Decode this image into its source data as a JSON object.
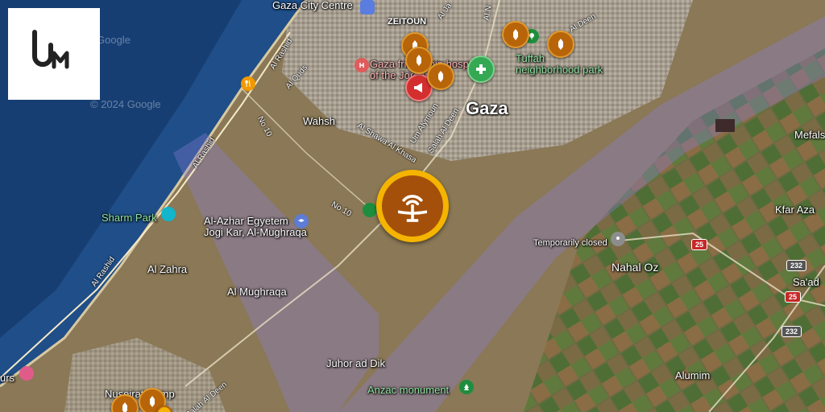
{
  "map": {
    "places": {
      "gaza_city_centre": "Gaza City Centre",
      "zeitoun": "ZEITOUN",
      "gaza": "Gaza",
      "wahsh": "Wahsh",
      "tuffah_park": "Tuffah\nneighborhood park",
      "sharm_park": "Sharm Park",
      "al_azhar": "Al-Azhar Egyetem\nJogi Kar, Al-Mughraqa",
      "al_zahra": "Al Zahra",
      "al_mughraqa": "Al Mughraqa",
      "juhor_ad_dik": "Juhor ad Dik",
      "anzac_monument": "Anzac monument",
      "nahal_oz": "Nahal Oz",
      "kfar_aza": "Kfar Aza",
      "saad": "Sa'ad",
      "alumim": "Alumim",
      "mefals": "Mefals",
      "nuseirat_camp": "Nuseirat Camp",
      "urs": "urs",
      "temporarily_closed": "Temporarily closed",
      "gaza_hospital": "Gaza friendship hospital\nof the Jordan"
    },
    "roads": {
      "al_rashid_1": "Al Rashid",
      "al_rashid_2": "Al Rashid",
      "al_rashid_3": "Al Rashid",
      "al_quds": "Al Quds",
      "no10_a": "No 10",
      "no10_b": "No 10",
      "al_shawa": "Al Shawa Al Khasa",
      "um_alymoun": "Um Alymoun",
      "salah_al_deen_1": "Salah Al Deen",
      "salah_al_deen_2": "Salah Al Deen",
      "al_deen": "Al Deen",
      "al_ja": "Al Ja",
      "al_n": "Al N"
    },
    "shields": {
      "r25a": "25",
      "r25b": "25",
      "r232a": "232",
      "r232b": "232"
    },
    "watermarks": {
      "google": "Google",
      "copyright": "© 2024 Google"
    },
    "colors": {
      "marker_ring": "#f4b400",
      "marker_fill": "#a4500b",
      "pin_fill": "#b8650a",
      "zone": "#8a7fd6"
    }
  }
}
